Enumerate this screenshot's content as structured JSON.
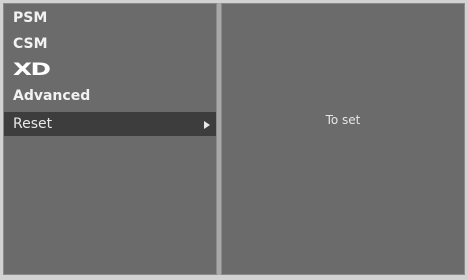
{
  "menu": {
    "items": [
      {
        "label": "PSM"
      },
      {
        "label": "CSM"
      },
      {
        "label": "XD"
      },
      {
        "label": "Advanced"
      },
      {
        "label": "Reset"
      }
    ],
    "selected_index": 4
  },
  "submenu": {
    "value": "To set"
  },
  "colors": {
    "panel": "#6b6b6b",
    "highlight": "#3d3d3d",
    "text": "#f2f2f2"
  }
}
